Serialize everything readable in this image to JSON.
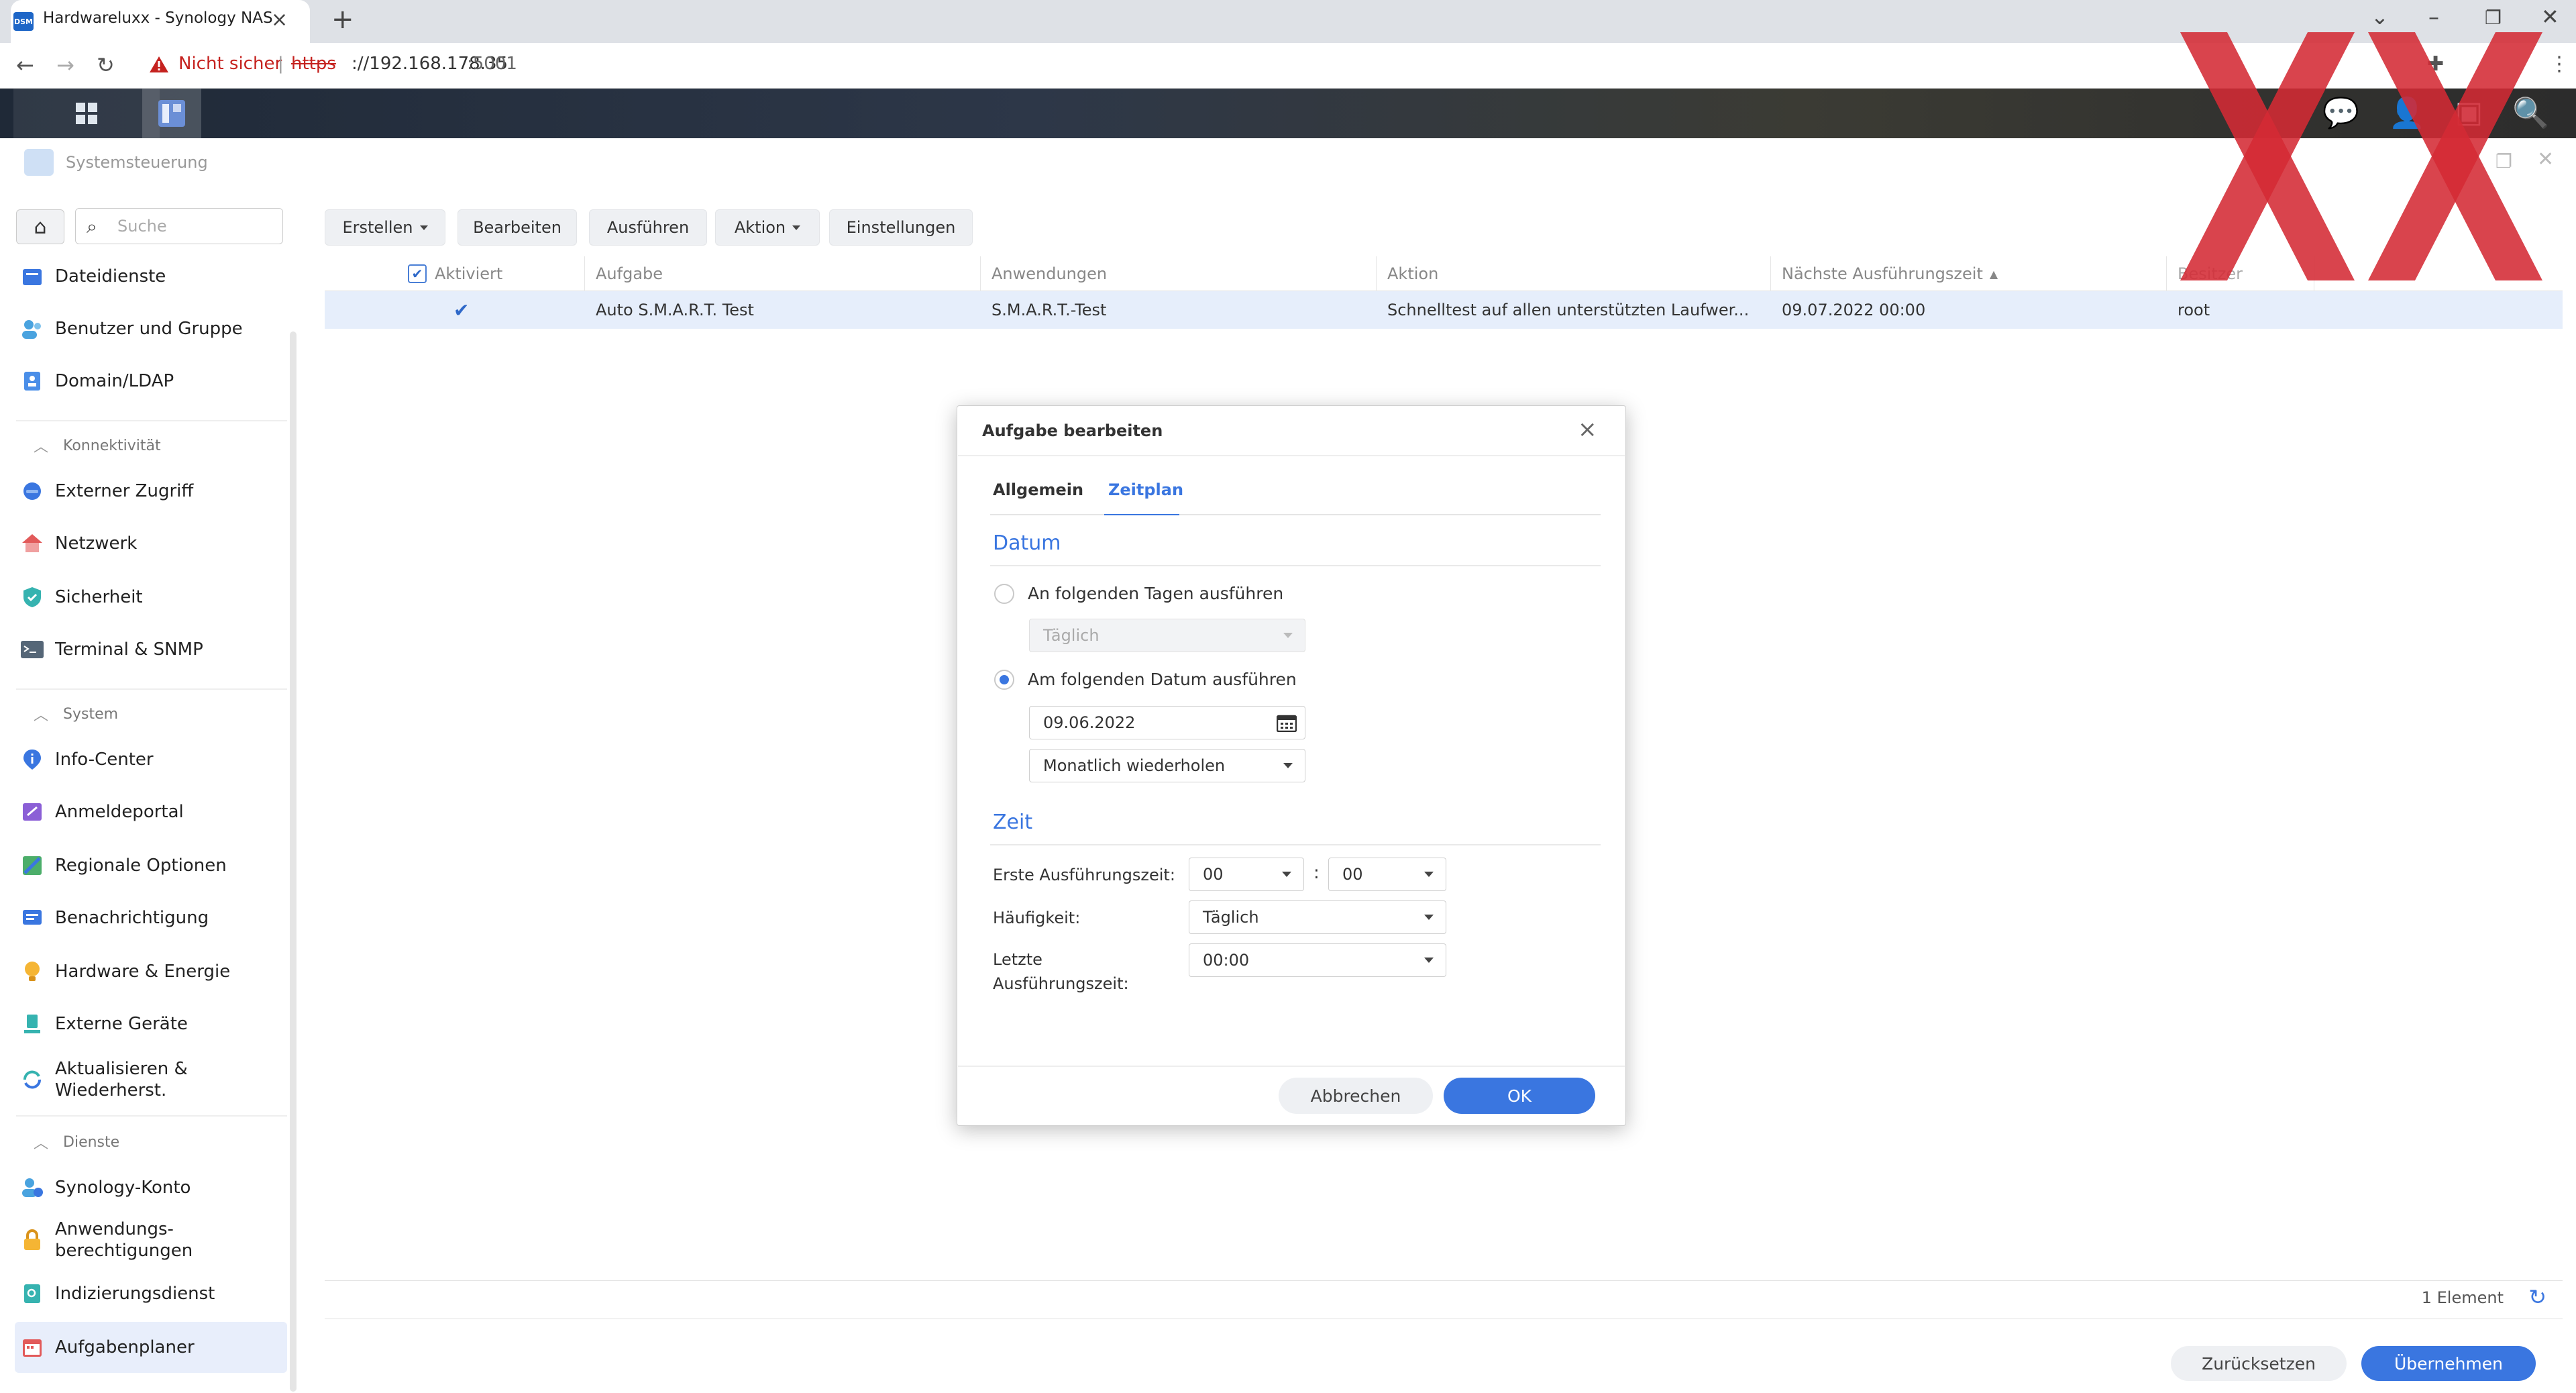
{
  "browser": {
    "tab_title": "Hardwareluxx - Synology NAS",
    "tab_favicon_text": "DSM",
    "not_secure": "Nicht sicher",
    "url_scheme": "https",
    "url_host": "://192.168.178.35",
    "url_port": ":5001"
  },
  "window": {
    "title": "Systemsteuerung"
  },
  "sidebar": {
    "search_placeholder": "Suche",
    "items": [
      {
        "label": "Dateidienste",
        "icon": "folder-share-icon"
      },
      {
        "label": "Benutzer und Gruppe",
        "icon": "users-icon"
      },
      {
        "label": "Domain/LDAP",
        "icon": "domain-icon"
      },
      {
        "label": "Externer Zugriff",
        "icon": "globe-link-icon"
      },
      {
        "label": "Netzwerk",
        "icon": "house-network-icon"
      },
      {
        "label": "Sicherheit",
        "icon": "shield-icon"
      },
      {
        "label": "Terminal & SNMP",
        "icon": "terminal-icon"
      },
      {
        "label": "Info-Center",
        "icon": "info-icon"
      },
      {
        "label": "Anmeldeportal",
        "icon": "portal-icon"
      },
      {
        "label": "Regionale Optionen",
        "icon": "region-icon"
      },
      {
        "label": "Benachrichtigung",
        "icon": "message-icon"
      },
      {
        "label": "Hardware & Energie",
        "icon": "lightbulb-icon"
      },
      {
        "label": "Externe Geräte",
        "icon": "usb-device-icon"
      },
      {
        "label": "Aktualisieren &\nWiederherst.",
        "icon": "update-icon"
      },
      {
        "label": "Synology-Konto",
        "icon": "account-icon"
      },
      {
        "label": "Anwendungs-\nberechtigungen",
        "icon": "lock-icon"
      },
      {
        "label": "Indizierungsdienst",
        "icon": "index-icon"
      },
      {
        "label": "Aufgabenplaner",
        "icon": "calendar-icon"
      }
    ],
    "sections": {
      "konnektivitaet": "Konnektivität",
      "system": "System",
      "dienste": "Dienste"
    }
  },
  "toolbar": {
    "erstellen": "Erstellen",
    "bearbeiten": "Bearbeiten",
    "ausfuehren": "Ausführen",
    "aktion": "Aktion",
    "einstellungen": "Einstellungen"
  },
  "table": {
    "columns": [
      "Aktiviert",
      "Aufgabe",
      "Anwendungen",
      "Aktion",
      "Nächste Ausführungszeit",
      "Besitzer"
    ],
    "rows": [
      {
        "aktiviert": true,
        "aufgabe": "Auto S.M.A.R.T. Test",
        "anwendungen": "S.M.A.R.T.-Test",
        "aktion": "Schnelltest auf allen unterstützten Laufwer...",
        "naechste": "09.07.2022 00:00",
        "besitzer": "root"
      }
    ]
  },
  "footer": {
    "count": "1 Element",
    "reset": "Zurücksetzen",
    "apply": "Übernehmen"
  },
  "dialog": {
    "title": "Aufgabe bearbeiten",
    "tabs": [
      "Allgemein",
      "Zeitplan"
    ],
    "active_tab": "Zeitplan",
    "datum": {
      "title": "Datum",
      "option_days": "An folgenden Tagen ausführen",
      "days_value": "Täglich",
      "option_date": "Am folgenden Datum ausführen",
      "date_value": "09.06.2022",
      "repeat_value": "Monatlich wiederholen",
      "selected": "date"
    },
    "zeit": {
      "title": "Zeit",
      "first_label": "Erste Ausführungszeit:",
      "first_hour": "00",
      "first_minute": "00",
      "colon": ":",
      "freq_label": "Häufigkeit:",
      "freq_value": "Täglich",
      "last_label": "Letzte\nAusführungszeit:",
      "last_value": "00:00"
    },
    "cancel": "Abbrechen",
    "ok": "OK"
  },
  "colors": {
    "accent": "#3a76e0",
    "selected_row": "#e6eefb",
    "watermark": "#d42a34"
  }
}
